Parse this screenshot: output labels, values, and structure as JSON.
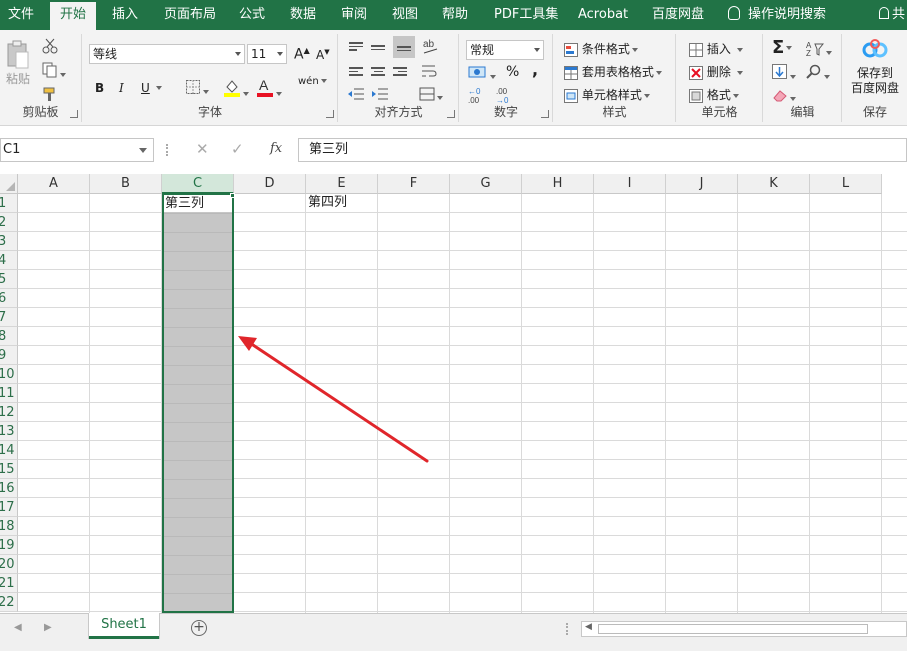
{
  "tabs": [
    "文件",
    "开始",
    "插入",
    "页面布局",
    "公式",
    "数据",
    "审阅",
    "视图",
    "帮助",
    "PDF工具集",
    "Acrobat",
    "百度网盘"
  ],
  "active_tab": "开始",
  "tell_me": "操作说明搜索",
  "share": "共",
  "ribbon": {
    "clipboard": {
      "label": "剪贴板",
      "paste": "粘贴"
    },
    "font": {
      "label": "字体",
      "name": "等线",
      "size": "11",
      "bold": "B",
      "italic": "I",
      "underline": "U",
      "grow": "A",
      "shrink": "A",
      "wen": "wén"
    },
    "alignment": {
      "label": "对齐方式"
    },
    "number": {
      "label": "数字",
      "format": "常规",
      "percent": "%",
      "comma": ",",
      "currency": "¥"
    },
    "styles": {
      "label": "样式",
      "conditional": "条件格式",
      "table": "套用表格格式",
      "cell_styles": "单元格样式"
    },
    "cells": {
      "label": "单元格",
      "insert": "插入",
      "delete": "删除",
      "format": "格式"
    },
    "editing": {
      "label": "编辑"
    },
    "save": {
      "label": "保存",
      "line1": "保存到",
      "line2": "百度网盘"
    }
  },
  "formula_bar": {
    "name_box": "C1",
    "fx": "fx",
    "value": "第三列"
  },
  "columns": [
    "A",
    "B",
    "C",
    "D",
    "E",
    "F",
    "G",
    "H",
    "I",
    "J",
    "K",
    "L"
  ],
  "rows": [
    "1",
    "2",
    "3",
    "4",
    "5",
    "6",
    "7",
    "8",
    "9",
    "10",
    "11",
    "12",
    "13",
    "14",
    "15",
    "16",
    "17",
    "18",
    "19",
    "20",
    "21",
    "22"
  ],
  "cells": {
    "C1": "第三列",
    "E1": "第四列"
  },
  "sheet_tab": "Sheet1",
  "colors": {
    "accent": "#217346",
    "selection": "#c6c6c6",
    "arrow": "#e0262b"
  }
}
